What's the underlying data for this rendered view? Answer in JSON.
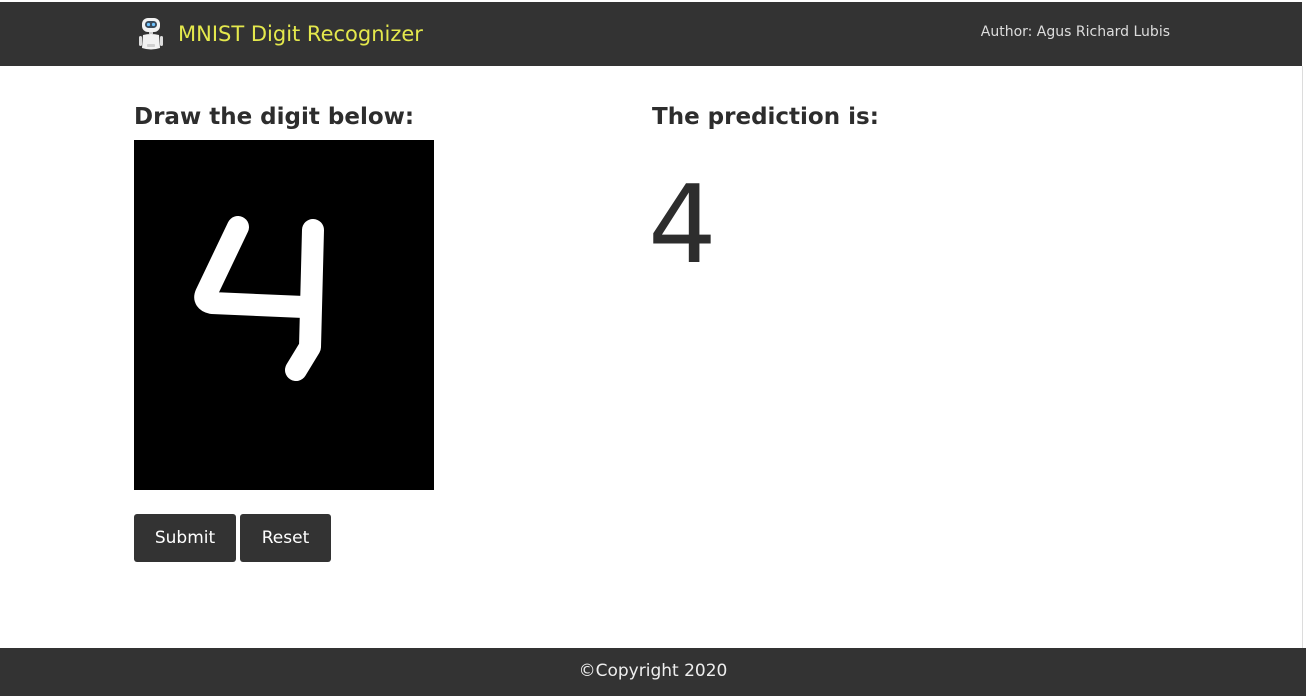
{
  "header": {
    "brand_icon": "robot-icon",
    "title": "MNIST Digit Recognizer",
    "author": "Author: Agus Richard Lubis"
  },
  "draw": {
    "heading": "Draw the digit below:",
    "drawn_digit": "4"
  },
  "buttons": {
    "submit": "Submit",
    "reset": "Reset"
  },
  "prediction": {
    "heading": "The prediction is:",
    "value": "4"
  },
  "footer": {
    "copyright": "©Copyright 2020"
  },
  "colors": {
    "navbar": "#333333",
    "brand": "#e4e84c",
    "canvas_bg": "#000000",
    "stroke": "#ffffff"
  }
}
